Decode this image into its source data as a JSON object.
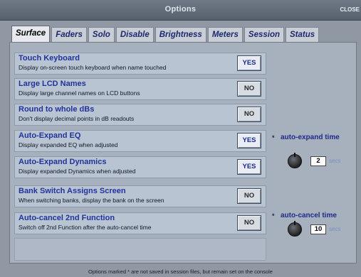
{
  "window": {
    "title": "Options",
    "close_label": "CLOSE"
  },
  "tabs": [
    {
      "label": "Surface",
      "active": true
    },
    {
      "label": "Faders"
    },
    {
      "label": "Solo"
    },
    {
      "label": "Disable"
    },
    {
      "label": "Brightness"
    },
    {
      "label": "Meters"
    },
    {
      "label": "Session"
    },
    {
      "label": "Status"
    }
  ],
  "options": [
    {
      "title": "Touch Keyboard",
      "desc": "Display on-screen touch keyboard when name touched",
      "value": "YES"
    },
    {
      "title": "Large LCD Names",
      "desc": "Display large channel names on LCD buttons",
      "value": "NO"
    },
    {
      "title": "Round to whole dBs",
      "desc": "Don't display decimal points in dB readouts",
      "value": "NO"
    },
    {
      "title": "Auto-Expand EQ",
      "desc": "Display expanded EQ when adjusted",
      "value": "YES"
    },
    {
      "title": "Auto-Expand Dynamics",
      "desc": "Display expanded Dynamics when adjusted",
      "value": "YES"
    },
    {
      "title": "Bank Switch Assigns Screen",
      "desc": "When switching banks, display the bank on the screen",
      "value": "NO"
    },
    {
      "title": "Auto-cancel 2nd Function",
      "desc": "Switch off 2nd Function after the auto-cancel time",
      "value": "NO"
    }
  ],
  "auto_expand": {
    "star": "*",
    "label": "auto-expand time",
    "value": "2",
    "unit": "secs"
  },
  "auto_cancel": {
    "star": "*",
    "label": "auto-cancel time",
    "value": "10",
    "unit": "secs"
  },
  "footer": "Options marked * are not saved in session files, but remain set on the console",
  "colors": {
    "accent": "#21329a",
    "panel": "#a7b0bd",
    "row": "#b9c4d3"
  }
}
